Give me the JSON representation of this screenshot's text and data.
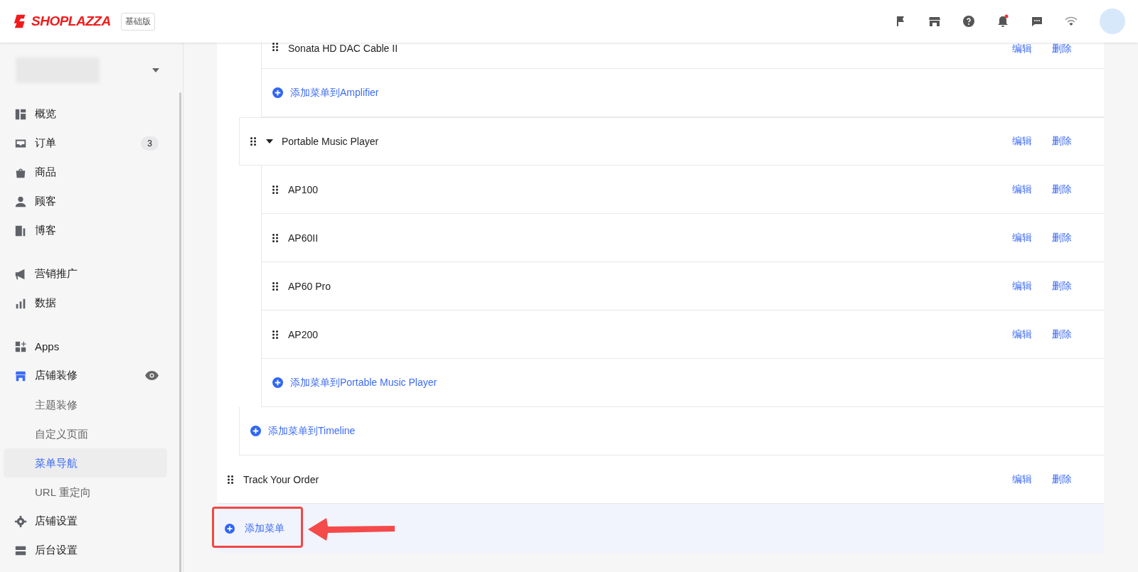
{
  "header": {
    "logo_text": "SHOPLAZZA",
    "plan_badge": "基础版",
    "notification_unread": true
  },
  "sidebar": {
    "groups": [
      [
        {
          "label": "概览",
          "active": false
        },
        {
          "label": "订单",
          "badge": "3",
          "active": false
        },
        {
          "label": "商品",
          "active": false
        },
        {
          "label": "顾客",
          "active": false
        },
        {
          "label": "博客",
          "active": false
        }
      ],
      [
        {
          "label": "营销推广",
          "active": false
        },
        {
          "label": "数据",
          "active": false
        }
      ],
      [
        {
          "label": "Apps",
          "active": false
        },
        {
          "label": "店铺装修",
          "active": true,
          "children": [
            {
              "label": "主题装修",
              "selected": false
            },
            {
              "label": "自定义页面",
              "selected": false
            },
            {
              "label": "菜单导航",
              "selected": true
            },
            {
              "label": "URL 重定向",
              "selected": false
            }
          ]
        },
        {
          "label": "店铺设置",
          "active": false
        },
        {
          "label": "后台设置",
          "active": false
        }
      ]
    ]
  },
  "menu_list": {
    "items": [
      {
        "kind": "group",
        "children": [
          {
            "kind": "group",
            "children": [
              {
                "kind": "item",
                "label": "Sonata HD DAC Cable II",
                "edit": "编辑",
                "delete": "删除"
              },
              {
                "kind": "add",
                "label": "添加菜单到Amplifier"
              }
            ]
          },
          {
            "kind": "item",
            "label": "Portable Music Player",
            "expanded": true,
            "edit": "编辑",
            "delete": "删除",
            "children": [
              {
                "kind": "item",
                "label": "AP100",
                "edit": "编辑",
                "delete": "删除"
              },
              {
                "kind": "item",
                "label": "AP60II",
                "edit": "编辑",
                "delete": "删除"
              },
              {
                "kind": "item",
                "label": "AP60 Pro",
                "edit": "编辑",
                "delete": "删除"
              },
              {
                "kind": "item",
                "label": "AP200",
                "edit": "编辑",
                "delete": "删除"
              },
              {
                "kind": "add",
                "label": "添加菜单到Portable Music Player"
              }
            ]
          },
          {
            "kind": "add",
            "label": "添加菜单到Timeline"
          }
        ]
      },
      {
        "kind": "item",
        "label": "Track Your Order",
        "edit": "编辑",
        "delete": "删除"
      }
    ],
    "add_button": "添加菜单"
  }
}
